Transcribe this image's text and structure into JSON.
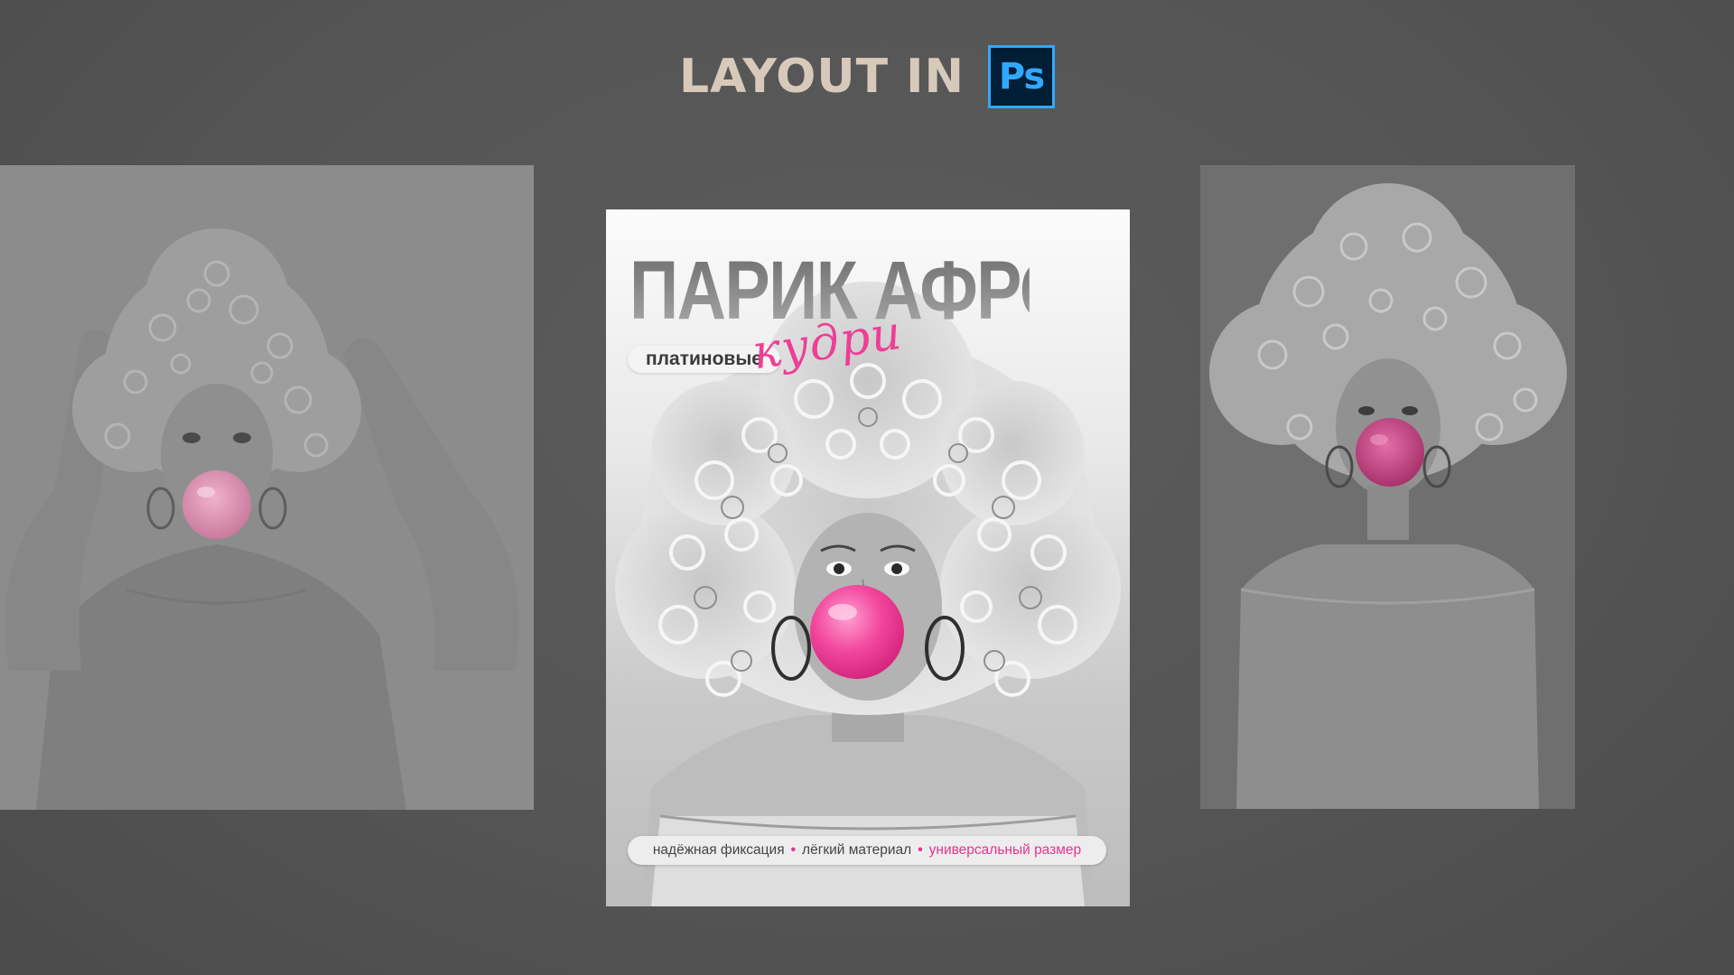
{
  "header": {
    "title": "LAYOUT IN",
    "logo_text": "Ps",
    "logo_colors": {
      "background": "#001e36",
      "accent": "#31a8ff"
    }
  },
  "poster": {
    "title": "ПАРИК АФРО",
    "subtitle": "платиновые",
    "script_word": "кудри",
    "features": [
      {
        "text": "надёжная фиксация",
        "highlight": false
      },
      {
        "text": "лёгкий материал",
        "highlight": false
      },
      {
        "text": "универсальный размер",
        "highlight": true
      }
    ],
    "separator": "•",
    "accent_color": "#ee3e95"
  }
}
